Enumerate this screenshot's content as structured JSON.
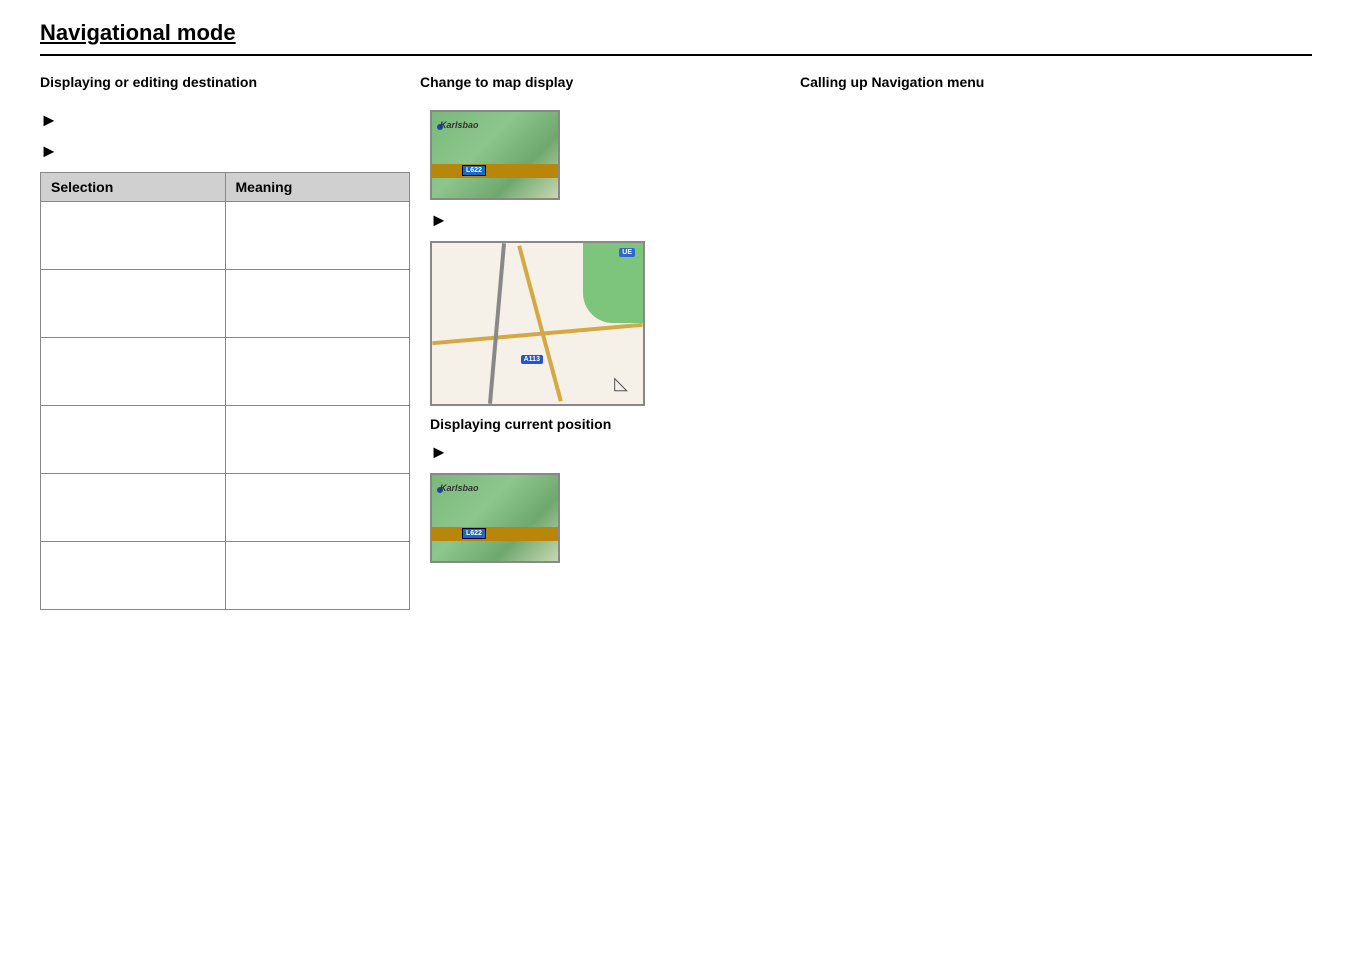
{
  "page": {
    "title": "Navigational mode"
  },
  "columns": {
    "col1_header": "Displaying or editing destination",
    "col2_header": "Change to map display",
    "col3_header": "Calling up Navigation menu"
  },
  "table": {
    "col1_header": "Selection",
    "col2_header": "Meaning",
    "rows": [
      {
        "selection": "",
        "meaning": ""
      },
      {
        "selection": "",
        "meaning": ""
      },
      {
        "selection": "",
        "meaning": ""
      },
      {
        "selection": "",
        "meaning": ""
      },
      {
        "selection": "",
        "meaning": ""
      },
      {
        "selection": "",
        "meaning": ""
      }
    ]
  },
  "arrows": {
    "symbol": "►"
  },
  "labels": {
    "displaying_current_position": "Displaying current position"
  },
  "maps": {
    "karlsbad_text": "Karlsbao",
    "street_badge": "A113",
    "ue_badge": "UE"
  }
}
